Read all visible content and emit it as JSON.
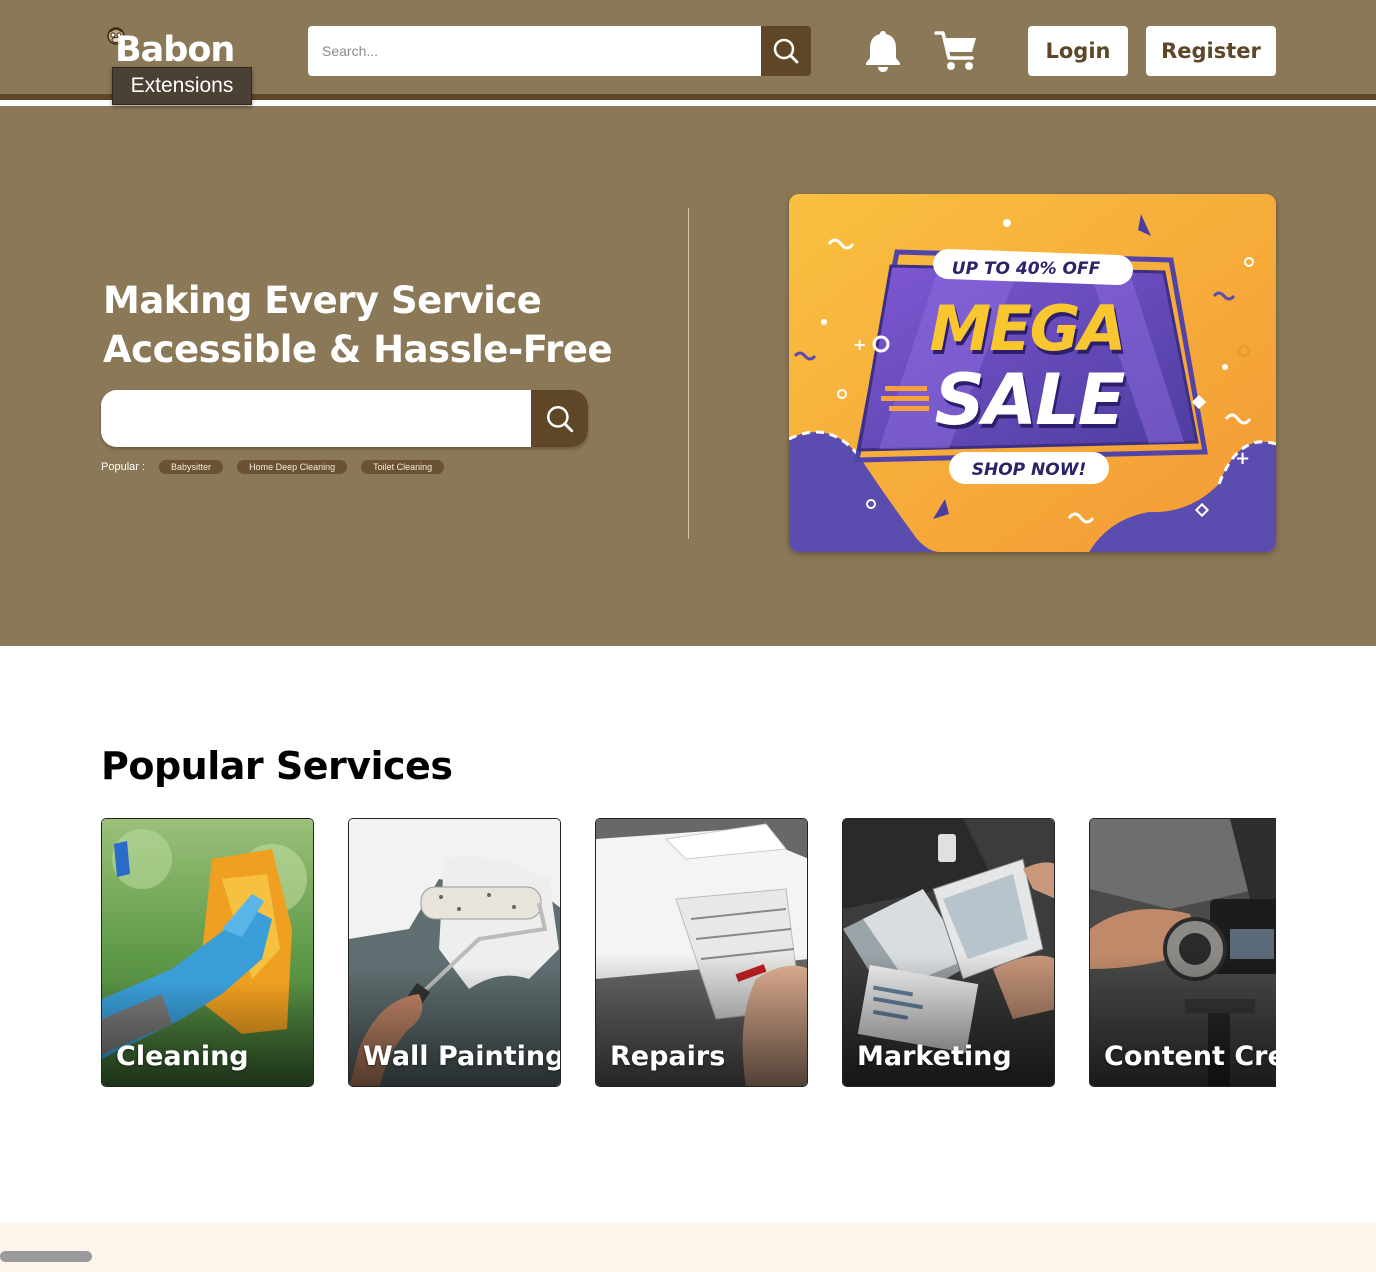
{
  "brand": {
    "name": "Babon",
    "tooltip": "Extensions"
  },
  "header": {
    "search_placeholder": "Search...",
    "login_label": "Login",
    "register_label": "Register",
    "icons": [
      "search-icon",
      "bell-icon",
      "cart-icon"
    ]
  },
  "hero": {
    "title_line1": "Making Every Service",
    "title_line2": "Accessible & Hassle-Free",
    "search_placeholder": "",
    "popular_label": "Popular :",
    "popular_tags": [
      "Babysitter",
      "Home Deep Cleaning",
      "Toilet Cleaning"
    ],
    "promo": {
      "line1": "UP TO 40% OFF",
      "line2": "MEGA",
      "line3": "SALE",
      "cta": "SHOP NOW!"
    }
  },
  "popular_services": {
    "title": "Popular Services",
    "items": [
      {
        "label": "Cleaning"
      },
      {
        "label": "Wall Painting"
      },
      {
        "label": "Repairs"
      },
      {
        "label": "Marketing"
      },
      {
        "label": "Content Cre"
      }
    ]
  },
  "colors": {
    "brand": "#8b7857",
    "brand_dark": "#5e4626",
    "footer": "#fbf5ec"
  }
}
